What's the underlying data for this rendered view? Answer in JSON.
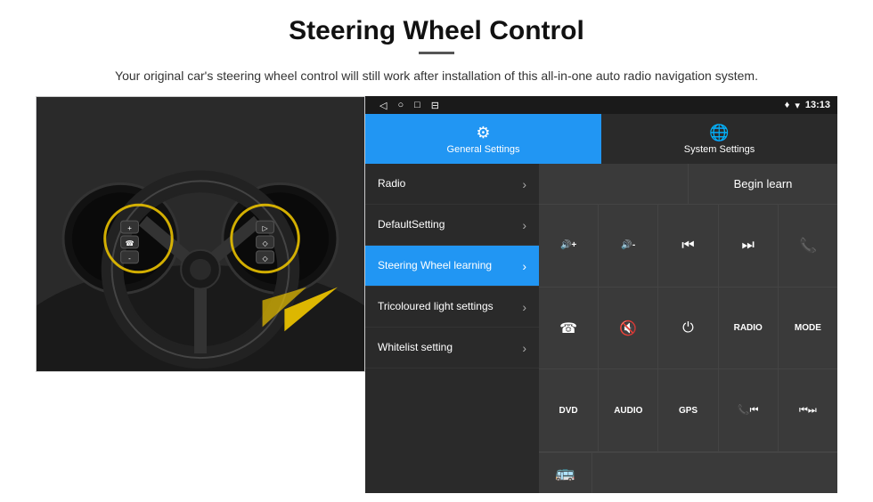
{
  "header": {
    "title": "Steering Wheel Control",
    "subtitle": "Your original car's steering wheel control will still work after installation of this all-in-one auto radio navigation system."
  },
  "status_bar": {
    "time": "13:13",
    "icons": [
      "◁",
      "○",
      "□",
      "⊟"
    ]
  },
  "tabs": [
    {
      "label": "General Settings",
      "icon": "⚙",
      "active": true
    },
    {
      "label": "System Settings",
      "icon": "🌐",
      "active": false
    }
  ],
  "menu_items": [
    {
      "label": "Radio",
      "active": false
    },
    {
      "label": "DefaultSetting",
      "active": false
    },
    {
      "label": "Steering Wheel learning",
      "active": true
    },
    {
      "label": "Tricoloured light settings",
      "active": false
    },
    {
      "label": "Whitelist setting",
      "active": false
    }
  ],
  "begin_learn_label": "Begin learn",
  "controls": {
    "row1": [
      {
        "icon": "🔊+",
        "type": "text"
      },
      {
        "icon": "🔊-",
        "type": "text"
      },
      {
        "icon": "⏮",
        "type": "icon"
      },
      {
        "icon": "⏭",
        "type": "icon"
      },
      {
        "icon": "📞",
        "type": "icon"
      }
    ],
    "row2": [
      {
        "icon": "📞",
        "type": "icon"
      },
      {
        "icon": "🔇",
        "type": "icon"
      },
      {
        "icon": "⏻",
        "type": "icon"
      },
      {
        "icon": "RADIO",
        "type": "text"
      },
      {
        "icon": "MODE",
        "type": "text"
      }
    ],
    "row3": [
      {
        "icon": "DVD",
        "type": "text"
      },
      {
        "icon": "AUDIO",
        "type": "text"
      },
      {
        "icon": "GPS",
        "type": "text"
      },
      {
        "icon": "📞⏮",
        "type": "text"
      },
      {
        "icon": "⏮⏭",
        "type": "text"
      }
    ]
  },
  "bus_icon": "🚌"
}
